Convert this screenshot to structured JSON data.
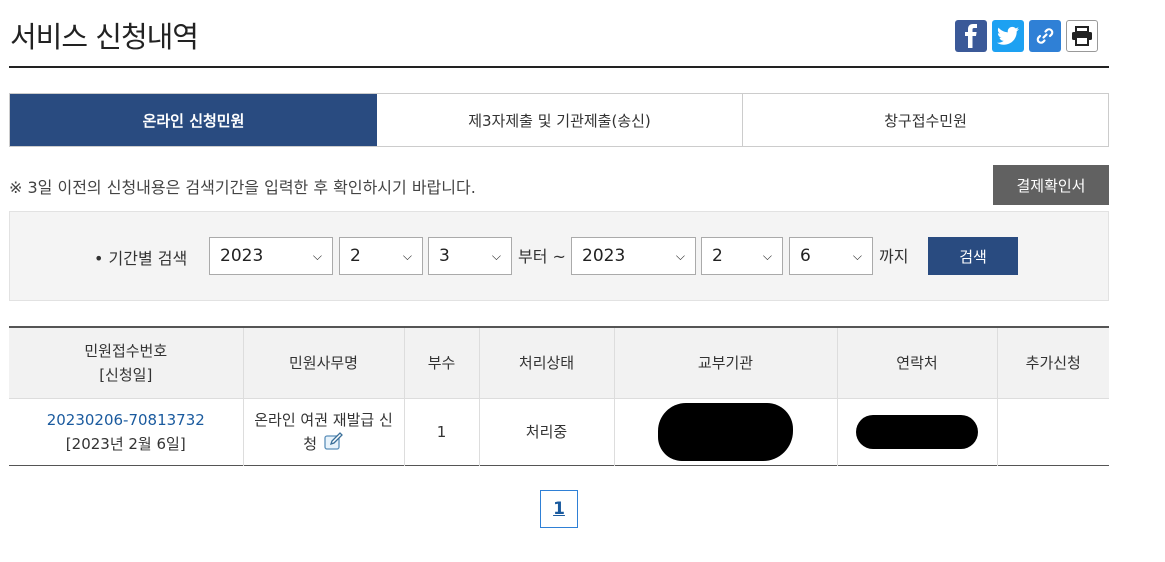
{
  "page": {
    "title": "서비스 신청내역"
  },
  "share": {
    "icons": [
      "facebook-icon",
      "twitter-icon",
      "link-icon",
      "print-icon"
    ],
    "colors": {
      "facebook": "#3b5998",
      "twitter": "#1da1f2",
      "link": "#2f80d6"
    }
  },
  "tabs": [
    {
      "label": "온라인 신청민원",
      "active": true
    },
    {
      "label": "제3자제출 및 기관제출(송신)",
      "active": false
    },
    {
      "label": "창구접수민원",
      "active": false
    }
  ],
  "notice": "※ 3일 이전의 신청내용은 검색기간을 입력한 후 확인하시기 바랍니다.",
  "receipt_button": "결제확인서",
  "search": {
    "label": "• 기간별 검색",
    "from": {
      "year": "2023",
      "month": "2",
      "day": "3"
    },
    "from_suffix": "부터 ~",
    "to": {
      "year": "2023",
      "month": "2",
      "day": "6"
    },
    "to_suffix": "까지",
    "button": "검색"
  },
  "table": {
    "headers": {
      "receipt_no": "민원접수번호",
      "receipt_date": "[신청일]",
      "name": "민원사무명",
      "copies": "부수",
      "status": "처리상태",
      "agency": "교부기관",
      "contact": "연락처",
      "extra": "추가신청"
    },
    "rows": [
      {
        "receipt_no": "20230206-70813732",
        "receipt_date": "[2023년 2월 6일]",
        "name_line1": "온라인 여권 재발급 신",
        "name_line2": "청",
        "copies": "1",
        "status": "처리중",
        "agency": "",
        "contact": "",
        "extra": ""
      }
    ]
  },
  "pagination": {
    "current": "1"
  },
  "colors": {
    "primary": "#294b80",
    "gray_button": "#616161",
    "link": "#1a5a9e"
  }
}
